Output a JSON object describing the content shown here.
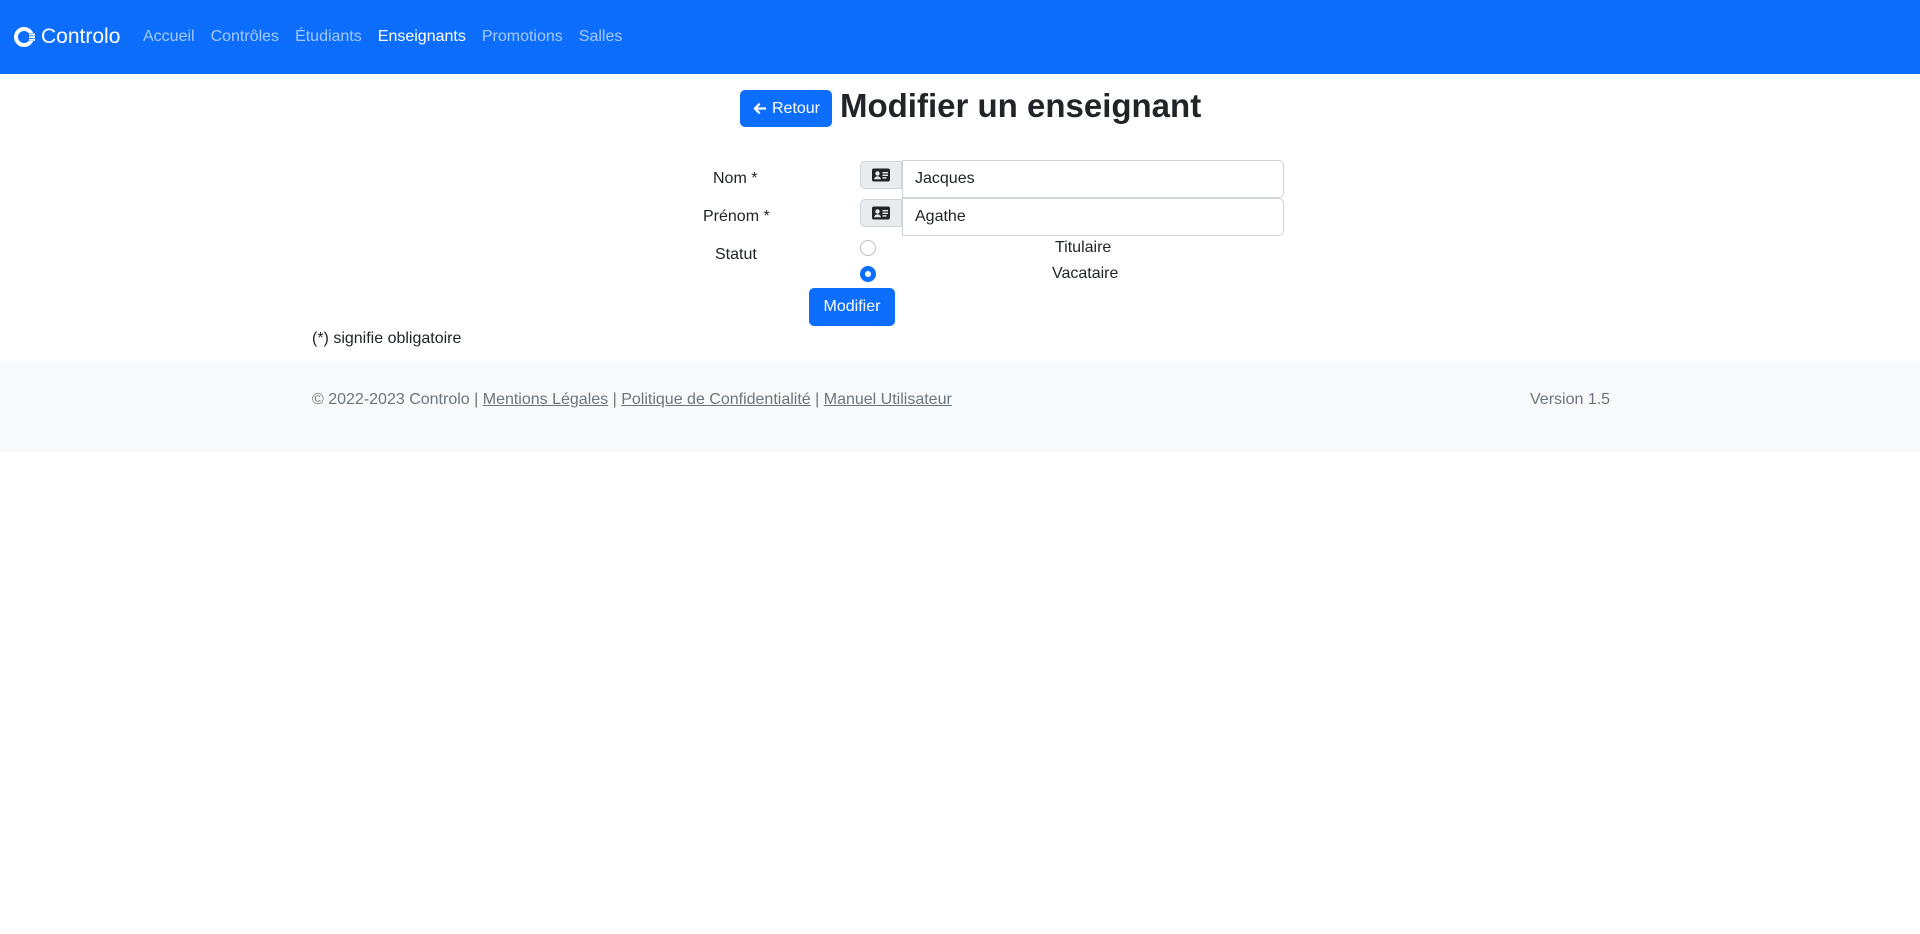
{
  "navbar": {
    "brand": "Controlo",
    "items": [
      {
        "label": "Accueil",
        "active": false
      },
      {
        "label": "Contrôles",
        "active": false
      },
      {
        "label": "Étudiants",
        "active": false
      },
      {
        "label": "Enseignants",
        "active": true
      },
      {
        "label": "Promotions",
        "active": false
      },
      {
        "label": "Salles",
        "active": false
      }
    ]
  },
  "header": {
    "back_label": "Retour",
    "title": "Modifier un enseignant"
  },
  "form": {
    "nom": {
      "label": "Nom *",
      "value": "Jacques",
      "icon": "id-card-icon"
    },
    "prenom": {
      "label": "Prénom *",
      "value": "Agathe",
      "icon": "id-card-icon"
    },
    "statut": {
      "label": "Statut",
      "options": [
        {
          "label": "Titulaire",
          "checked": false
        },
        {
          "label": "Vacataire",
          "checked": true
        }
      ]
    },
    "submit_label": "Modifier",
    "required_note": "(*) signifie obligatoire"
  },
  "footer": {
    "copyright": "© 2022-2023 Controlo",
    "separator": "|",
    "links": [
      "Mentions Légales",
      "Politique de Confidentialité",
      "Manuel Utilisateur"
    ],
    "version": "Version 1.5"
  },
  "colors": {
    "primary": "#0d6efd",
    "footer_bg": "#f8f9fa",
    "muted": "#6c757d"
  }
}
